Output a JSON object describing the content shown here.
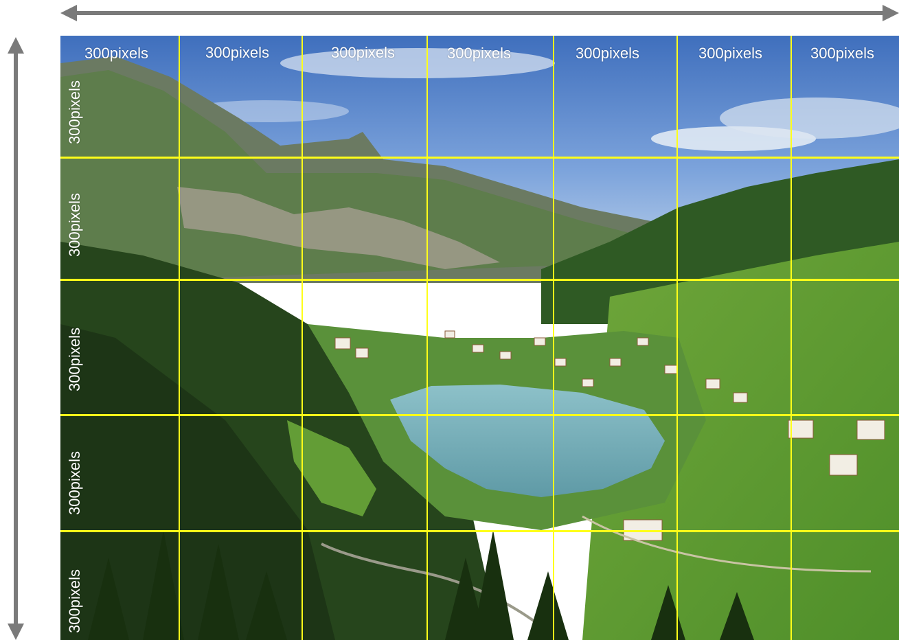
{
  "figure": {
    "subject": "valley-landscape-photo",
    "grid": {
      "columns": 7,
      "rows": 5,
      "line_color": "#ffff19",
      "column_labels": [
        "300pixels",
        "300pixels",
        "300pixels",
        "300pixels",
        "300pixels",
        "300pixels",
        "300pixels"
      ],
      "row_labels": [
        "300pixels",
        "300pixels",
        "300pixels",
        "300pixels",
        "300pixels"
      ]
    },
    "arrows": {
      "color": "#7a7a7a",
      "horizontal": "double-headed",
      "vertical": "double-headed"
    }
  }
}
